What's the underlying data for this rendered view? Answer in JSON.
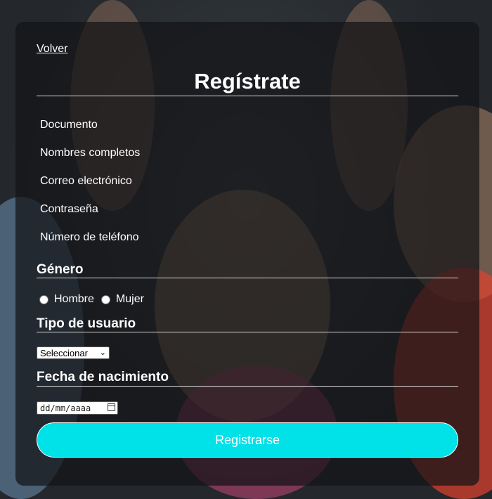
{
  "nav": {
    "back_label": "Volver"
  },
  "form": {
    "title": "Regístrate",
    "fields": [
      {
        "label": "Documento"
      },
      {
        "label": "Nombres completos"
      },
      {
        "label": "Correo electrónico"
      },
      {
        "label": "Contraseña"
      },
      {
        "label": "Número de teléfono"
      }
    ],
    "gender": {
      "title": "Género",
      "options": [
        "Hombre",
        "Mujer"
      ]
    },
    "user_type": {
      "title": "Tipo de usuario",
      "selected": "Seleccionar"
    },
    "birthdate": {
      "title": "Fecha de nacimiento",
      "placeholder": "dd/mm/aaaa"
    },
    "submit_label": "Registrarse"
  },
  "colors": {
    "accent": "#00e1e8",
    "panel": "#141416",
    "text": "#ffffff"
  },
  "icons": [
    "calendar-icon",
    "chevron-down-icon"
  ]
}
